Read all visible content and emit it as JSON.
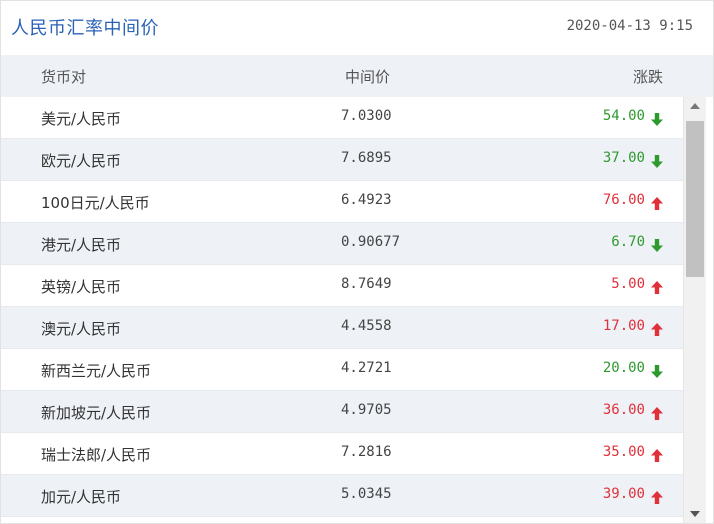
{
  "header": {
    "title": "人民币汇率中间价",
    "timestamp": "2020-04-13 9:15"
  },
  "table": {
    "columns": {
      "pair": "货币对",
      "mid": "中间价",
      "change": "涨跌"
    },
    "rows": [
      {
        "pair": "美元/人民币",
        "mid": "7.0300",
        "change": "54.00",
        "direction": "down"
      },
      {
        "pair": "欧元/人民币",
        "mid": "7.6895",
        "change": "37.00",
        "direction": "down"
      },
      {
        "pair": "100日元/人民币",
        "mid": "6.4923",
        "change": "76.00",
        "direction": "up"
      },
      {
        "pair": "港元/人民币",
        "mid": "0.90677",
        "change": "6.70",
        "direction": "down"
      },
      {
        "pair": "英镑/人民币",
        "mid": "8.7649",
        "change": "5.00",
        "direction": "up"
      },
      {
        "pair": "澳元/人民币",
        "mid": "4.4558",
        "change": "17.00",
        "direction": "up"
      },
      {
        "pair": "新西兰元/人民币",
        "mid": "4.2721",
        "change": "20.00",
        "direction": "down"
      },
      {
        "pair": "新加坡元/人民币",
        "mid": "4.9705",
        "change": "36.00",
        "direction": "up"
      },
      {
        "pair": "瑞士法郎/人民币",
        "mid": "7.2816",
        "change": "35.00",
        "direction": "up"
      },
      {
        "pair": "加元/人民币",
        "mid": "5.0345",
        "change": "39.00",
        "direction": "up"
      }
    ]
  },
  "icons": {
    "up": "arrow-up-icon",
    "down": "arrow-down-icon"
  },
  "colors": {
    "title": "#2a62b8",
    "up": "#e0303a",
    "down": "#2e9a2e",
    "header_bg": "#eef2f7"
  }
}
